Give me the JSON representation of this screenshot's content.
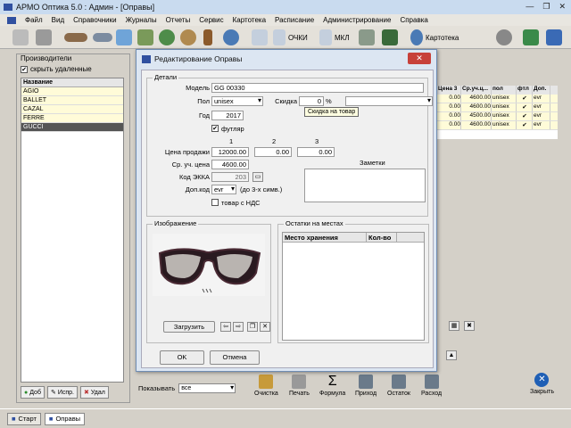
{
  "window": {
    "title": "АРМО Оптика 5.0 : Админ - [Оправы]"
  },
  "menu": [
    "Файл",
    "Вид",
    "Справочники",
    "Журналы",
    "Отчеты",
    "Сервис",
    "Картотека",
    "Расписание",
    "Администрирование",
    "Справка"
  ],
  "toolbar": {
    "points_label": "ОЧКИ",
    "mkl_label": "МКЛ",
    "card_label": "Картотека"
  },
  "left_panel": {
    "title": "Производители",
    "hide_deleted_label": "скрыть удаленные",
    "column_header": "Название",
    "items": [
      "AGIO",
      "BALLET",
      "CAZAL",
      "FERRE",
      "GUCCI"
    ],
    "selected_index": 4,
    "add_label": "Доб",
    "edit_label": "Испр.",
    "delete_label": "Удал"
  },
  "bg_grid": {
    "headers": [
      "Цена 3",
      "Ср.уч.ц...",
      "пол",
      "фтл",
      "Доп."
    ],
    "rows": [
      [
        "0.00",
        "4600.00",
        "unisex",
        "✔",
        "evr"
      ],
      [
        "0.00",
        "4600.00",
        "unisex",
        "✔",
        "evr"
      ],
      [
        "0.00",
        "4500.00",
        "unisex",
        "✔",
        "evr"
      ],
      [
        "0.00",
        "4600.00",
        "unisex",
        "✔",
        "evr"
      ]
    ]
  },
  "bottom": {
    "show_label": "Показывать",
    "show_value": "все",
    "actions": [
      "Очистка",
      "Печать",
      "Формула",
      "Приход",
      "Остаток",
      "Расход"
    ],
    "exit_label": "Закрыть"
  },
  "taskbar": {
    "start": "Старт",
    "frames": "Оправы"
  },
  "dialog": {
    "title": "Редактирование Оправы",
    "details_group": "Детали",
    "model_label": "Модель",
    "model_value": "GG 00330",
    "gender_label": "Пол",
    "gender_value": "unisex",
    "discount_label": "Скидка",
    "discount_value": "0",
    "percent": "%",
    "discount_tooltip": "Скидка на товар",
    "year_label": "Год",
    "year_value": "2017",
    "case_label": "футляр",
    "col1": "1",
    "col2": "2",
    "col3": "3",
    "price_label": "Цена продажи",
    "price1": "12000.00",
    "price2": "0.00",
    "price3": "0.00",
    "avg_price_label": "Ср. уч. цена",
    "avg_price_value": "4600.00",
    "ekka_label": "Код ЭККА",
    "ekka_value": "203",
    "extra_code_label": "Доп.код",
    "extra_code_value": "evr",
    "extra_code_hint": "(до 3-х симв.)",
    "vat_label": "товар с НДС",
    "notes_label": "Заметки",
    "image_group": "Изображение",
    "load_label": "Загрузить",
    "stock_group": "Остатки на местах",
    "stock_col1": "Место хранения",
    "stock_col2": "Кол-во",
    "ok_label": "OK",
    "cancel_label": "Отмена"
  }
}
